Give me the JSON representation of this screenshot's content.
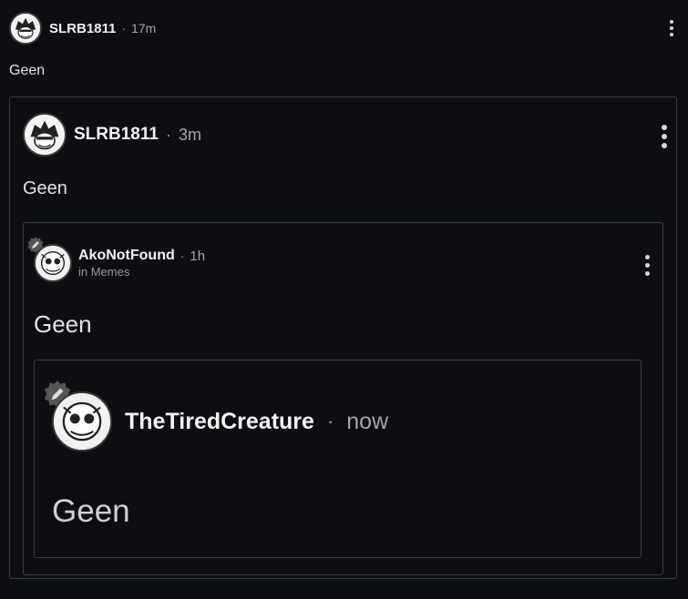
{
  "post1": {
    "username": "SLRB1811",
    "separator": "·",
    "time": "17m",
    "text": "Geen"
  },
  "post2": {
    "username": "SLRB1811",
    "separator": "·",
    "time": "3m",
    "text": "Geen"
  },
  "post3": {
    "username": "AkoNotFound",
    "separator": "·",
    "time": "1h",
    "community": "in Memes",
    "text": "Geen"
  },
  "post4": {
    "username": "TheTiredCreature",
    "separator": "·",
    "time": "now",
    "text": "Geen"
  },
  "icons": {
    "menu": "more-vertical-icon",
    "badge": "pencil-badge-icon"
  },
  "colors": {
    "background": "#0d0e12",
    "border": "#3b3d44",
    "text": "#e6e6e6",
    "muted": "#a6a6a6"
  }
}
